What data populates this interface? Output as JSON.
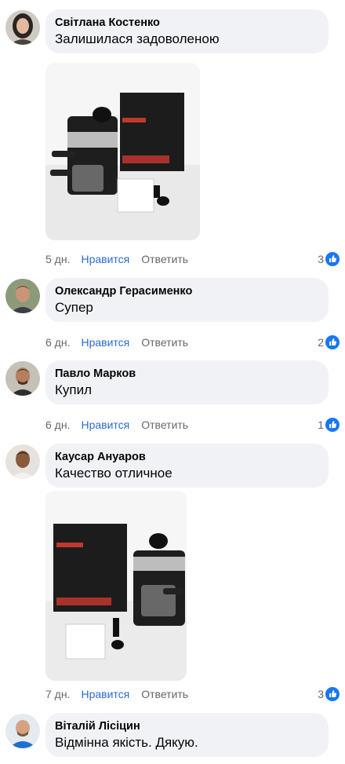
{
  "comments": [
    {
      "name": "Світлана Костенко",
      "text": "Залишилася задоволеною",
      "time": "5 дн.",
      "like": "Нравится",
      "reply": "Ответить",
      "reactions": "3"
    },
    {
      "name": "Олександр Герасименко",
      "text": "Супер",
      "time": "6 дн.",
      "like": "Нравится",
      "reply": "Ответить",
      "reactions": "2"
    },
    {
      "name": "Павло Марков",
      "text": "Купил",
      "time": "6 дн.",
      "like": "Нравится",
      "reply": "Ответить",
      "reactions": "1"
    },
    {
      "name": "Каусар Ануаров",
      "text": "Качество отличное",
      "time": "7 дн.",
      "like": "Нравится",
      "reply": "Ответить",
      "reactions": "3"
    },
    {
      "name": "Віталій Лісіцин",
      "text": "Відмінна якість. Дякую."
    }
  ],
  "colors": {
    "bubble": "#f0f2f5",
    "link": "#2a6bd6",
    "meta": "#65676b",
    "like_badge": "#1877f2"
  },
  "icons": {
    "reaction": "thumbs-up-icon"
  }
}
